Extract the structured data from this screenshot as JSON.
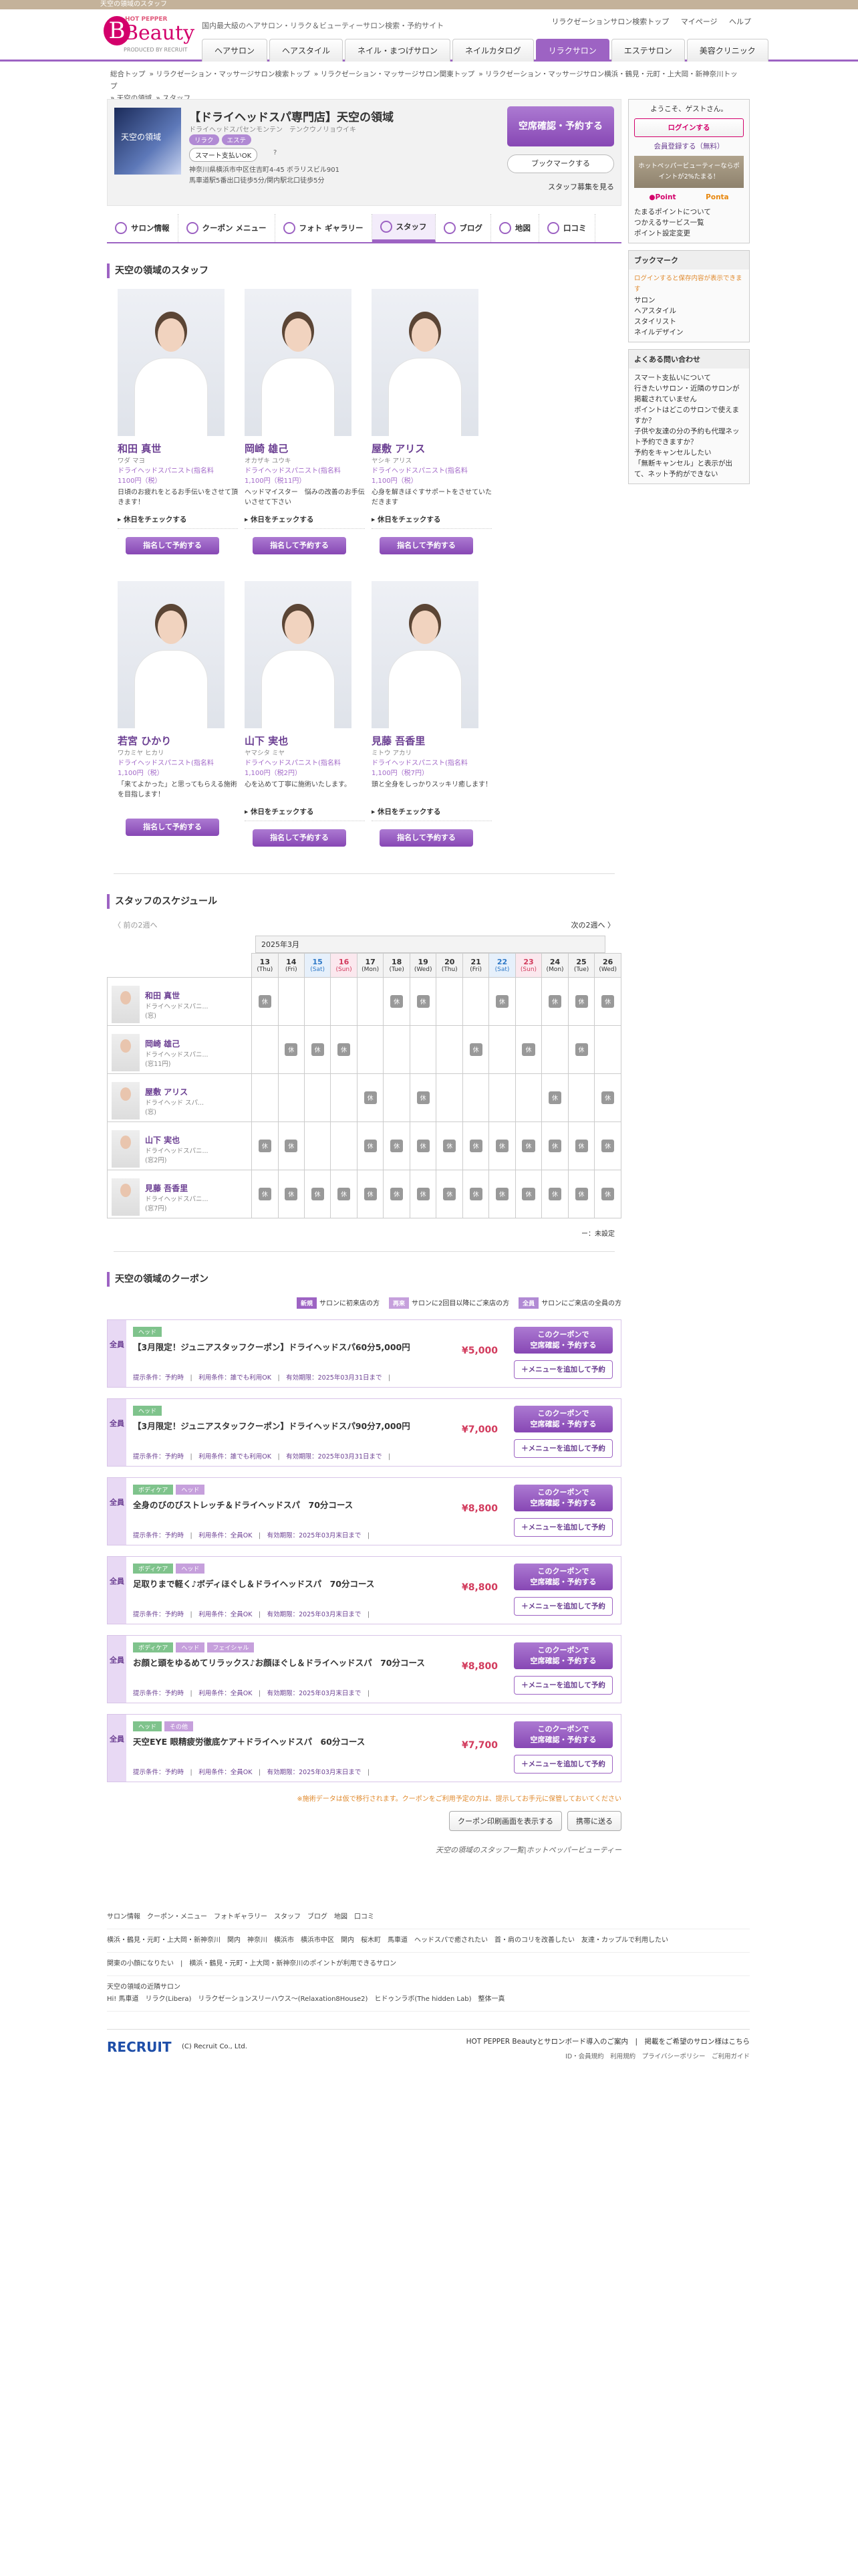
{
  "top_strip": "天空の領域のスタッフ",
  "brand": {
    "hotpepper": "HOT PEPPER",
    "beauty": "Beauty",
    "sub": "PRODUCED BY RECRUIT",
    "accent": "#9d63c3"
  },
  "tagline": "国内最大級のヘアサロン・リラク＆ビューティーサロン検索・予約サイト",
  "top_links": [
    "リラクゼーションサロン検索トップ",
    "マイページ",
    "ヘルプ"
  ],
  "nav_tabs": [
    "ヘアサロン",
    "ヘアスタイル",
    "ネイル・まつげサロン",
    "ネイルカタログ",
    "リラクサロン",
    "エステサロン",
    "美容クリニック"
  ],
  "breadcrumbs": [
    "総合トップ",
    "リラクゼーション・マッサージサロン検索トップ",
    "リラクゼーション・マッサージサロン関東トップ",
    "リラクゼーション・マッサージサロン横浜・鶴見・元町・上大岡・新神奈川トップ",
    "天空の領域",
    "スタッフ"
  ],
  "salon": {
    "image_text": "天空の領域",
    "name": "【ドライヘッドスパ専門店】天空の領域",
    "category": "ドライヘッドスパセンモンテン　テンクウノリョウイキ",
    "tags": [
      "リラク",
      "エステ"
    ],
    "payment": "スマート支払いOK",
    "address": "神奈川県横浜市中区住吉町4-45 ボラリスビル901",
    "access": "馬車道駅5番出口徒歩5分/関内駅北口徒歩5分",
    "reserve_label": "空席確認・予約する",
    "bookmark_label": "ブックマークする",
    "bookmark_link": "スタッフ募集を見る"
  },
  "salon_tabs": [
    "サロン情報",
    "クーポン メニュー",
    "フォト ギャラリー",
    "スタッフ",
    "ブログ",
    "地図",
    "口コミ"
  ],
  "staff_heading": "天空の領域のスタッフ",
  "staff": [
    {
      "name": "和田 真世",
      "kana": "ワダ マヨ",
      "role": "ドライヘッドスパニスト(指名料",
      "price": "1100円（税）",
      "msg": "日頃のお疲れをとるお手伝いをさせて頂きます！",
      "check": "休日をチェックする",
      "btn": "指名して予約する"
    },
    {
      "name": "岡崎 雄己",
      "kana": "オカザキ ユウキ",
      "role": "ドライヘッドスパニスト(指名料",
      "price": "1,100円（税11円）",
      "msg": "ヘッドマイスター　悩みの改善のお手伝いさせて下さい",
      "check": "休日をチェックする",
      "btn": "指名して予約する"
    },
    {
      "name": "屋敷 アリス",
      "kana": "ヤシキ アリス",
      "role": "ドライヘッドスパニスト(指名料",
      "price": "1,100円（税）",
      "msg": "心身を解きほぐすサポートをさせていただきます",
      "check": "休日をチェックする",
      "btn": "指名して予約する"
    },
    {
      "name": "若宮 ひかり",
      "kana": "ワカミヤ ヒカリ",
      "role": "ドライヘッドスパニスト(指名料",
      "price": "1,100円（税）",
      "msg": "「来てよかった」と思ってもらえる施術を目指します！",
      "check": "",
      "btn": "指名して予約する"
    },
    {
      "name": "山下 実也",
      "kana": "ヤマシタ ミヤ",
      "role": "ドライヘッドスパニスト(指名料",
      "price": "1,100円（税2円）",
      "msg": "心を込めて丁寧に施術いたします。",
      "check": "休日をチェックする",
      "btn": "指名して予約する"
    },
    {
      "name": "見藤 吾香里",
      "kana": "ミトウ アカリ",
      "role": "ドライヘッドスパニスト(指名料",
      "price": "1,100円（税7円）",
      "msg": "頭と全身をしっかりスッキリ癒します！",
      "check": "休日をチェックする",
      "btn": "指名して予約する"
    }
  ],
  "schedule": {
    "heading": "スタッフのスケジュール",
    "prev": "〈 前の2週へ",
    "next": "次の2週へ 〉",
    "month": "2025年3月",
    "days": [
      {
        "d": "13",
        "w": "(Thu)",
        "t": ""
      },
      {
        "d": "14",
        "w": "(Fri)",
        "t": ""
      },
      {
        "d": "15",
        "w": "(Sat)",
        "t": "sat"
      },
      {
        "d": "16",
        "w": "(Sun)",
        "t": "sun"
      },
      {
        "d": "17",
        "w": "(Mon)",
        "t": ""
      },
      {
        "d": "18",
        "w": "(Tue)",
        "t": ""
      },
      {
        "d": "19",
        "w": "(Wed)",
        "t": ""
      },
      {
        "d": "20",
        "w": "(Thu)",
        "t": ""
      },
      {
        "d": "21",
        "w": "(Fri)",
        "t": ""
      },
      {
        "d": "22",
        "w": "(Sat)",
        "t": "sat"
      },
      {
        "d": "23",
        "w": "(Sun)",
        "t": "sun"
      },
      {
        "d": "24",
        "w": "(Mon)",
        "t": ""
      },
      {
        "d": "25",
        "w": "(Tue)",
        "t": ""
      },
      {
        "d": "26",
        "w": "(Wed)",
        "t": ""
      }
    ],
    "off_label": "休",
    "rows": [
      {
        "name": "和田 真世",
        "role": "ドライヘッドスパニ...",
        "sub": "(窓)",
        "off": [
          0,
          5,
          6,
          9,
          11,
          12,
          13
        ]
      },
      {
        "name": "岡崎 雄己",
        "role": "ドライヘッドスパニ...",
        "sub": "(窓11円)",
        "off": [
          1,
          2,
          3,
          8,
          10,
          12
        ]
      },
      {
        "name": "屋敷 アリス",
        "role": "ドライヘッド スパ...",
        "sub": "(窓)",
        "off": [
          4,
          6,
          11,
          13
        ]
      },
      {
        "name": "山下 実也",
        "role": "ドライヘッドスパニ...",
        "sub": "(窓2円)",
        "off": [
          0,
          1,
          4,
          5,
          6,
          7,
          8,
          9,
          10,
          11,
          12,
          13
        ]
      },
      {
        "name": "見藤 吾香里",
        "role": "ドライヘッドスパニ...",
        "sub": "(窓7円)",
        "off": [
          0,
          1,
          2,
          3,
          4,
          5,
          6,
          7,
          8,
          9,
          10,
          11,
          12,
          13
        ]
      }
    ],
    "legend": "ー：未設定"
  },
  "coupons": {
    "heading": "天空の領域のクーポン",
    "legend": [
      {
        "badge": "新規",
        "text": "サロンに初来店の方",
        "color": "#9d63c3"
      },
      {
        "badge": "再来",
        "text": "サロンに2回目以降にご来店の方",
        "color": "#c6a0dc"
      },
      {
        "badge": "全員",
        "text": "サロンにご来店の全員の方",
        "color": "#b18ad4"
      }
    ],
    "side_label": "全員",
    "items": [
      {
        "tags": [
          "ヘッド"
        ],
        "name": "【3月限定！ジュニアスタッフクーポン】ドライヘッドスパ60分5,000円",
        "price": "¥5,000",
        "meta": [
          "提示条件：予約時",
          "利用条件：誰でも利用OK",
          "有効期限：2025年03月31日まで"
        ]
      },
      {
        "tags": [
          "ヘッド"
        ],
        "name": "【3月限定！ジュニアスタッフクーポン】ドライヘッドスパ90分7,000円",
        "price": "¥7,000",
        "meta": [
          "提示条件：予約時",
          "利用条件：誰でも利用OK",
          "有効期限：2025年03月31日まで"
        ]
      },
      {
        "tags": [
          "ボディケア",
          "ヘッド"
        ],
        "name": "全身のびのびストレッチ＆ドライヘッドスパ　70分コース",
        "price": "¥8,800",
        "meta": [
          "提示条件：予約時",
          "利用条件：全員OK",
          "有効期限：2025年03月末日まで"
        ]
      },
      {
        "tags": [
          "ボディケア",
          "ヘッド"
        ],
        "name": "足取りまで軽く♪ボディほぐし＆ドライヘッドスパ　70分コース",
        "price": "¥8,800",
        "meta": [
          "提示条件：予約時",
          "利用条件：全員OK",
          "有効期限：2025年03月末日まで"
        ]
      },
      {
        "tags": [
          "ボディケア",
          "ヘッド",
          "フェイシャル"
        ],
        "name": "お顔と頭をゆるめてリラックス♪お顔ほぐし＆ドライヘッドスパ　70分コース",
        "price": "¥8,800",
        "meta": [
          "提示条件：予約時",
          "利用条件：全員OK",
          "有効期限：2025年03月末日まで"
        ]
      },
      {
        "tags": [
          "ヘッド",
          "その他"
        ],
        "name": "天空EYE 眼精疲労徹底ケア＋ドライヘッドスパ　60分コース",
        "price": "¥7,700",
        "meta": [
          "提示条件：予約時",
          "利用条件：全員OK",
          "有効期限：2025年03月末日まで"
        ]
      }
    ],
    "btn1": "このクーポンで\n空席確認・予約する",
    "btn2": "＋メニューを追加して予約",
    "note": "※施術データは仮で移行されます。クーポンをご利用予定の方は、提示してお手元に保管しておいてください",
    "print_btn": "クーポン印刷画面を表示する",
    "mobile_btn": "携帯に送る",
    "footer_italic": "天空の領域のスタッフ一覧|ホットペッパービューティー"
  },
  "sidebar": {
    "welcome": "ようこそ、ゲストさん。",
    "login": "ログインする",
    "register": "会員登録する（無料）",
    "points_banner": "ホットペッパービューティーならポイントが2%たまる！",
    "points_links": [
      "たまるポイントについて",
      "つかえるサービス一覧",
      "ポイント設定変更"
    ],
    "bookmark_title": "ブックマーク",
    "bookmark_note": "ログインすると保存内容が表示できます",
    "bookmark_items": [
      "サロン",
      "ヘアスタイル",
      "スタイリスト",
      "ネイルデザイン"
    ],
    "faq_title": "よくある問い合わせ",
    "faq_items": [
      "スマート支払いについて",
      "行きたいサロン・近隣のサロンが掲載されていません",
      "ポイントはどこのサロンで使えますか？",
      "子供や友達の分の予約も代理ネット予約できますか？",
      "予約をキャンセルしたい",
      "「無断キャンセル」と表示が出て、ネット予約ができない"
    ]
  },
  "footer": {
    "row1": [
      "サロン情報",
      "クーポン・メニュー",
      "フォトギャラリー",
      "スタッフ",
      "ブログ",
      "地図",
      "口コミ"
    ],
    "row2": [
      "横浜・鶴見・元町・上大岡・新神奈川",
      "関内",
      "神奈川",
      "横浜市",
      "横浜市中区",
      "関内",
      "桜木町",
      "馬車道",
      "ヘッドスパで癒されたい",
      "首・肩のコリを改善したい",
      "友達・カップルで利用したい"
    ],
    "row3": "関東の小顔になりたい　|　横浜・鶴見・元町・上大岡・新神奈川のポイントが利用できるサロン",
    "row4_title": "天空の領域の近隣サロン",
    "row4": "Hi! 馬車道　リラク(Libera)　リラクゼーションスリーハウス〜(Relaxation8House2)　ヒドゥンラボ(The hidden Lab)　整体一真",
    "recruit": "RECRUIT",
    "copyright": "(C) Recruit Co., Ltd.",
    "right1": "HOT PEPPER Beautyとサロンボード導入のご案内　|　掲載をご希望のサロン様はこちら",
    "right2": "ID・会員規約　利用規約　プライバシーポリシー　ご利用ガイド"
  }
}
